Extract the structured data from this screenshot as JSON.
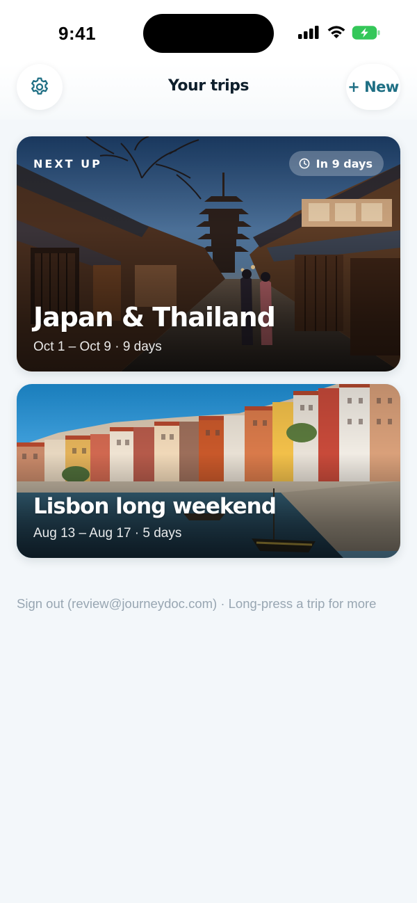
{
  "status_bar": {
    "time": "9:41",
    "icons": [
      "cellular-signal-icon",
      "wifi-icon",
      "battery-charging-icon"
    ]
  },
  "header": {
    "title": "Your trips",
    "settings_icon": "gear-icon",
    "new_button_label": "+ New"
  },
  "trips": [
    {
      "badge": "NEXT UP",
      "countdown": "In 9 days",
      "countdown_icon": "clock-icon",
      "title": "Japan & Thailand",
      "dates": "Oct 1 – Oct 9 · 9 days"
    },
    {
      "title": "Lisbon long weekend",
      "dates": "Aug 13 – Aug 17 · 5 days"
    }
  ],
  "footer": {
    "note": "Sign out (review@journeydoc.com) · Long-press a trip for more"
  },
  "colors": {
    "background": "#f3f7fa",
    "accent": "#1f6f84",
    "muted_text": "#98a6b2",
    "battery": "#34c759"
  }
}
